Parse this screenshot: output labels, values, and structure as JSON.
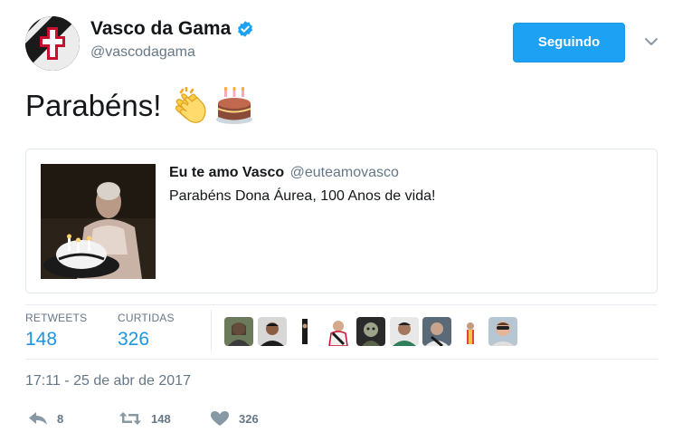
{
  "author": {
    "display_name": "Vasco da Gama",
    "handle": "@vascodagama",
    "verified": true
  },
  "follow_button": {
    "label": "Seguindo"
  },
  "tweet": {
    "text": "Parabéns!",
    "emojis": [
      "clapping-hands",
      "birthday-cake"
    ]
  },
  "quoted_tweet": {
    "display_name": "Eu te amo Vasco",
    "handle": "@euteamovasco",
    "text": "Parabéns Dona Áurea, 100 Anos de vida!"
  },
  "stats": {
    "retweets_label": "RETWEETS",
    "retweets_value": "148",
    "likes_label": "CURTIDAS",
    "likes_value": "326",
    "liker_avatar_count": 9
  },
  "timestamp": "17:11 - 25 de abr de 2017",
  "actions": {
    "reply_count": "8",
    "retweet_count": "148",
    "like_count": "326"
  },
  "colors": {
    "accent": "#1da1f2",
    "link_blue": "#1b95e0",
    "secondary_text": "#657786",
    "primary_text": "#14171a",
    "border": "#e1e8ed"
  }
}
